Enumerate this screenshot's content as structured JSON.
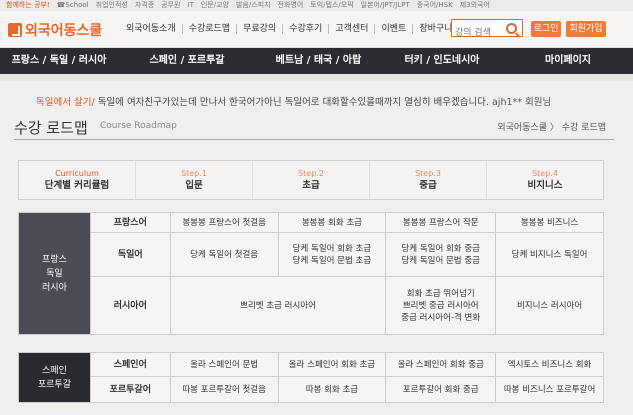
{
  "topstrip": [
    "함께하는 공부!",
    "☎School",
    "취업인적성",
    "자격증",
    "공무원",
    "IT",
    "인문/교양",
    "발음/스피치",
    "전화영어",
    "토익/텝스/오픽",
    "일본어/JPT/JLPT",
    "중국어/HSK",
    "제3외국어"
  ],
  "logo": "외국어동스쿨",
  "topnav": [
    "외국어동소개",
    "수강로드맵",
    "무료강의",
    "수강후기",
    "고객센터",
    "이벤트",
    "장바구니"
  ],
  "search": {
    "placeholder": "강의 검색"
  },
  "buttons": {
    "login": "로그인",
    "join": "회원가입"
  },
  "mainnav": [
    "프랑스 / 독일 / 러시아",
    "스페인 / 포르투갈",
    "베트남 / 태국 / 아랍",
    "터키 / 인도네시아",
    "마이페이지"
  ],
  "notice": {
    "tag": "독일에서 살기/",
    "text": "독일에 여자친구가있는데 만나서 한국어가아닌 독일어로 대화할수있을때까지 열심히 배우겠습니다.",
    "user": "ajh1** 회원님"
  },
  "page": {
    "title": "수강 로드맵",
    "subtitle": "Course Roadmap",
    "breadcrumb": "외국어동스쿨 〉 수강 로드맵"
  },
  "steps": [
    {
      "sm": "Curriculum",
      "lg": "단계별 커리큘럼"
    },
    {
      "sm": "Step.1",
      "lg": "입문"
    },
    {
      "sm": "Step.2",
      "lg": "초급"
    },
    {
      "sm": "Step.3",
      "lg": "중급"
    },
    {
      "sm": "Step.4",
      "lg": "비지니스"
    }
  ],
  "table1": {
    "group": "프랑스\n독일\n러시아",
    "french": {
      "lang": "프랑스어",
      "c1": "봉봉봉 프랑스어 첫걸음",
      "c2": "봉봉봉 회화 초급",
      "c3": "봉봉봉 프랑스어 작문",
      "c4": "봉봉봉 비즈니스"
    },
    "german": {
      "lang": "독일어",
      "c1": "당케 독일어 첫걸음",
      "c2a": "당케 독일어 회화 초급",
      "c2b": "당케 독일어 문법 초급",
      "c3a": "당케 독일어 회화 중급",
      "c3b": "당케 독일어 문법 중급",
      "c4": "당케 비지니스 독일어"
    },
    "russian": {
      "lang": "러시아어",
      "c12": "쁘리벳 초급 러시아어",
      "c3a": "회화 초급 뛰어넘기",
      "c3b": "쁘리벳 중급 러시아어",
      "c3c": "중급 러시아어-격 변화",
      "c4": "비지니스 러시아어"
    }
  },
  "table2": {
    "group": "스페인\n포르투갈",
    "spanish": {
      "lang": "스페인어",
      "c1": "올라 스페인어 문법",
      "c2": "올라 스페인어 회화 초급",
      "c3": "올라 스페인어 회화 중급",
      "c4": "엑시토스 비즈니스 회화"
    },
    "portuguese": {
      "lang": "포르투갈어",
      "c1": "따봉 포르투갈어 첫걸음",
      "c2": "따봉 회화 초급",
      "c3": "포르투갈어 회화 중급",
      "c4": "따봉 비즈니스 포르투갈어"
    }
  },
  "colors": {
    "accent": "#f07a3a",
    "nav": "#2b2d33",
    "group": "#4a4b54"
  }
}
